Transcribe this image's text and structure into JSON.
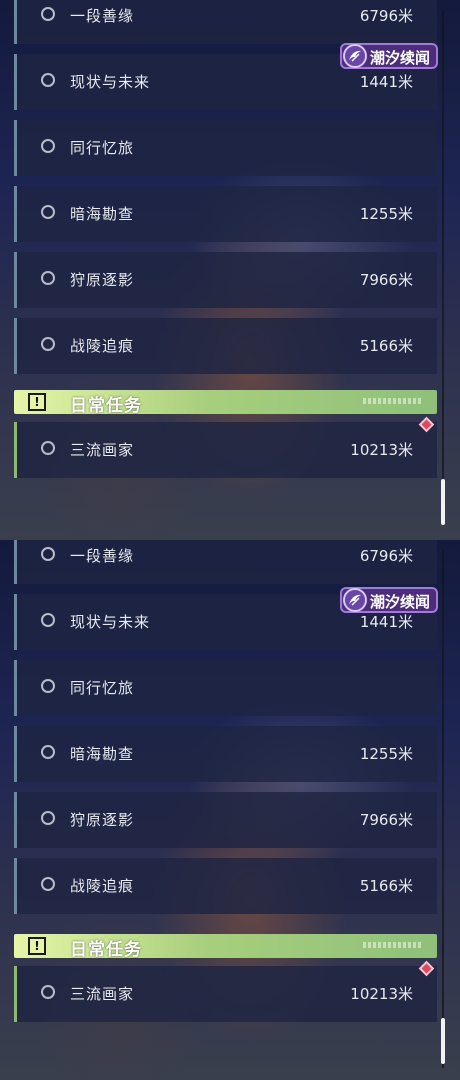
{
  "badge": {
    "label": "潮汐续闻"
  },
  "section": {
    "title": "日常任务"
  },
  "quests": [
    {
      "name": "一段善缘",
      "distance": "6796米"
    },
    {
      "name": "现状与未来",
      "distance": "1441米"
    },
    {
      "name": "同行忆旅",
      "distance": ""
    },
    {
      "name": "暗海勘查",
      "distance": "1255米"
    },
    {
      "name": "狩原逐影",
      "distance": "7966米"
    },
    {
      "name": "战陵追痕",
      "distance": "5166米"
    }
  ],
  "daily": [
    {
      "name": "三流画家",
      "distance": "10213米"
    }
  ],
  "colors": {
    "section_accent": "#a7cf7d",
    "badge_bg": "#4b2d7a",
    "alert": "#e0475e"
  },
  "icons": {
    "section": "exclamation-icon",
    "badge": "tide-icon",
    "alert": "alert-diamond-icon"
  }
}
